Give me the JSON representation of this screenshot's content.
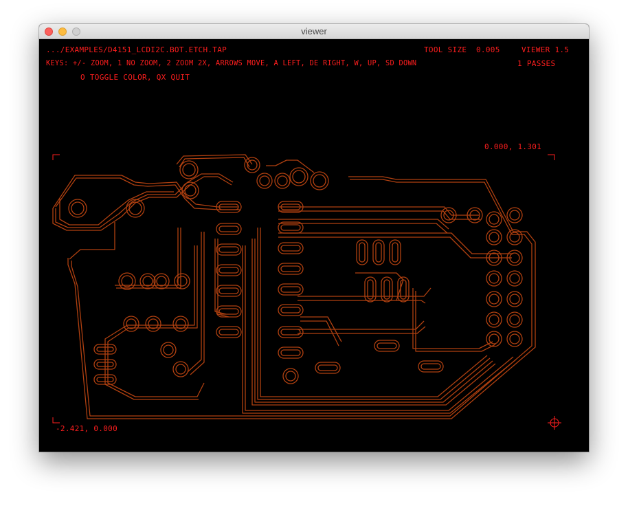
{
  "window": {
    "title": "viewer"
  },
  "hud": {
    "file_path": ".../EXAMPLES/D4151_LCDI2C.BOT.ETCH.TAP",
    "tool_size_label": "TOOL SIZE",
    "tool_size_value": "0.005",
    "app_version": "VIEWER 1.5",
    "keys_line1": "KEYS: +/- ZOOM, 1 NO ZOOM, 2 ZOOM 2X, ARROWS MOVE, A LEFT, DE RIGHT, W, UP, SD DOWN",
    "passes": "1 PASSES",
    "keys_line2": "O TOGGLE COLOR, QX QUIT",
    "coord_top_right": "0.000, 1.301",
    "coord_bottom_left": "-2.421, 0.000"
  },
  "colors": {
    "trace": "#b04010",
    "hud_text": "#ff1e1e",
    "background": "#000000"
  },
  "icons": {
    "origin_marker": "crosshair-icon"
  }
}
